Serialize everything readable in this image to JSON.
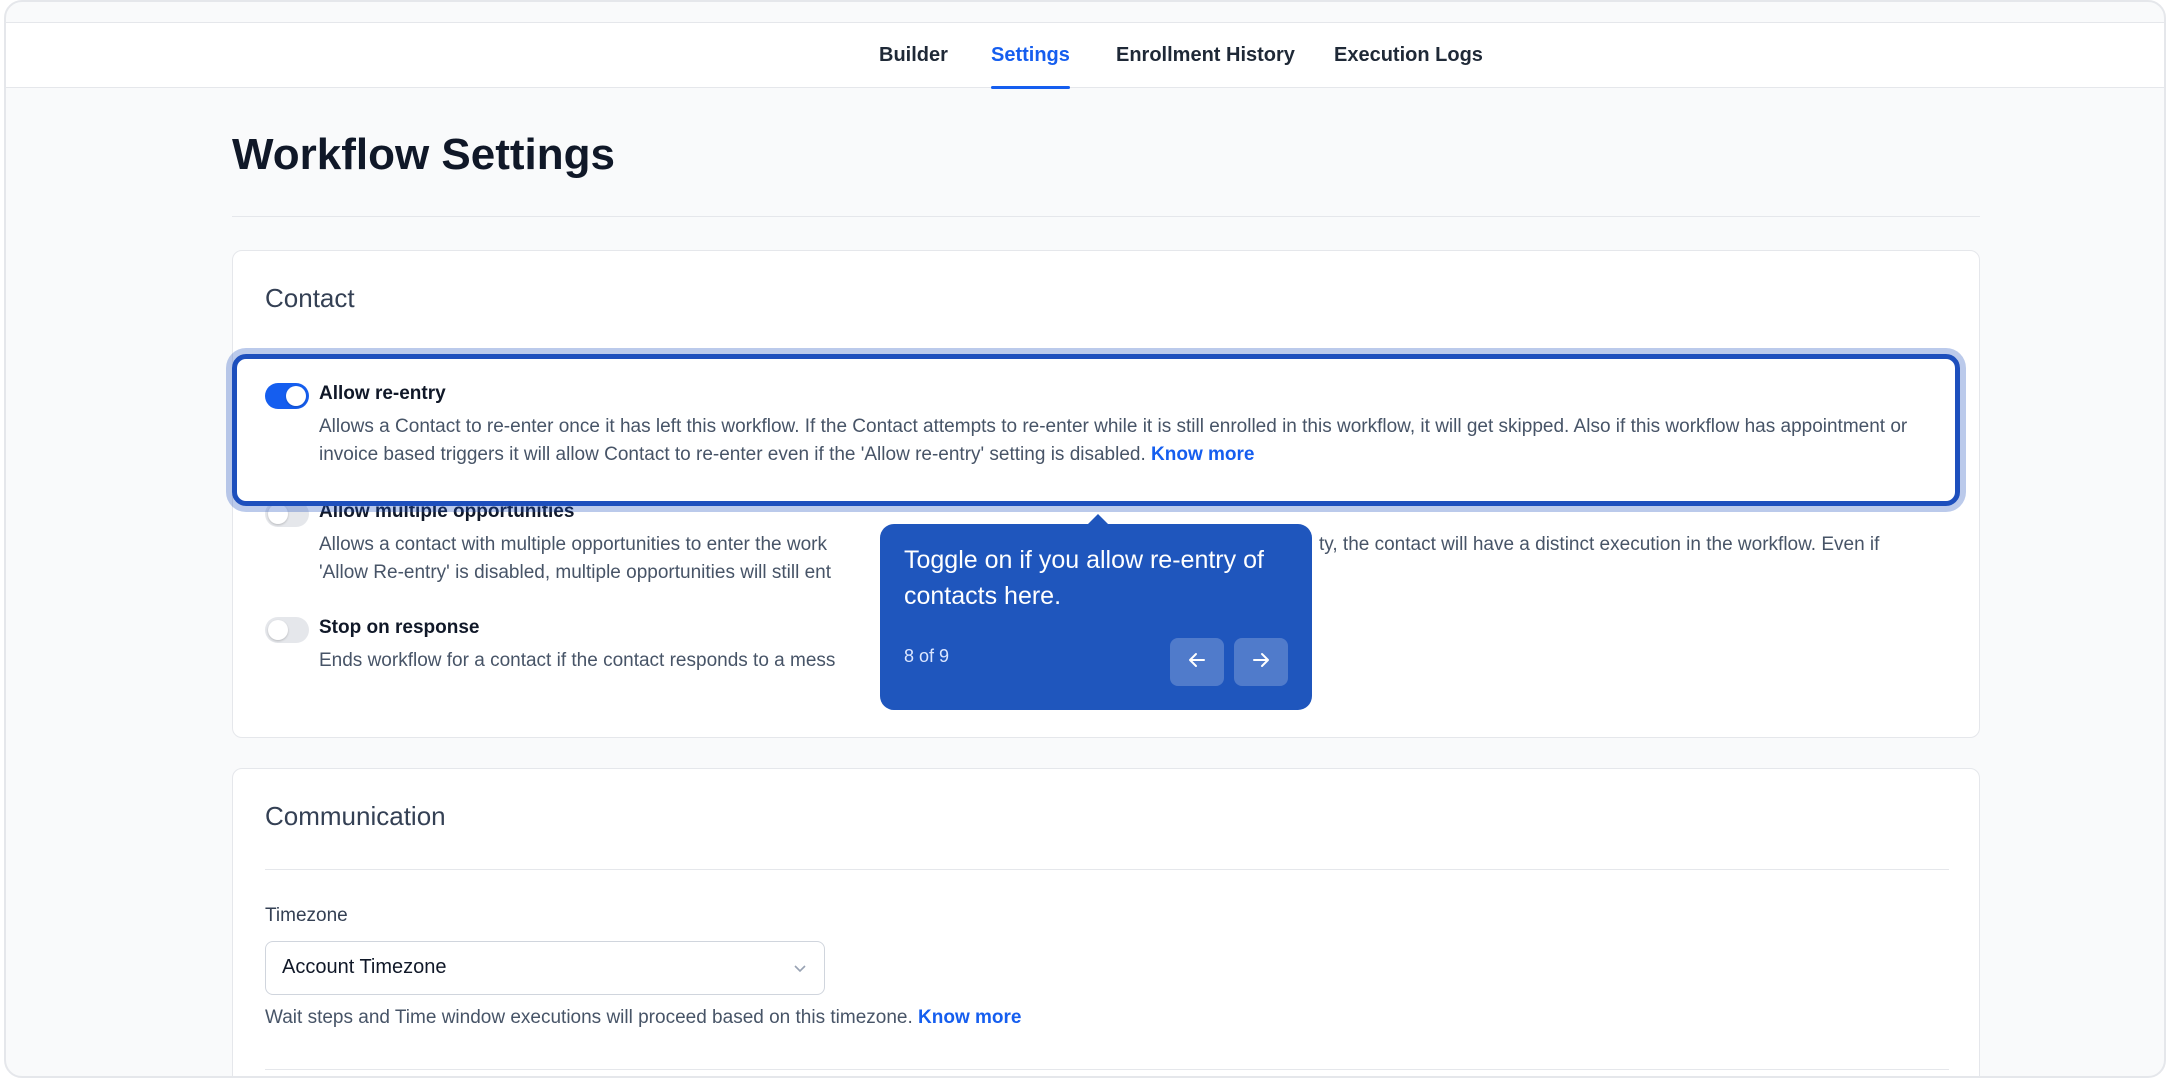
{
  "tabs": [
    {
      "label": "Builder"
    },
    {
      "label": "Settings"
    },
    {
      "label": "Enrollment History"
    },
    {
      "label": "Execution Logs"
    }
  ],
  "page_title": "Workflow Settings",
  "contact": {
    "title": "Contact",
    "settings": [
      {
        "label": "Allow re-entry",
        "enabled": true,
        "description": "Allows a Contact to re-enter once it has left this workflow. If the Contact attempts to re-enter while it is still enrolled in this workflow, it will get skipped. Also if this workflow has appointment or invoice based triggers it will allow Contact to re-enter even if the 'Allow re-entry' setting is disabled.",
        "link": "Know more"
      },
      {
        "label": "Allow multiple opportunities",
        "enabled": false,
        "description_start": "Allows a contact with multiple opportunities to enter the work",
        "description_end": "ty, the contact will have a distinct execution in the workflow. Even if",
        "description_line2": "'Allow Re-entry' is disabled, multiple opportunities will still ent"
      },
      {
        "label": "Stop on response",
        "enabled": false,
        "description": "Ends workflow for a contact if the contact responds to a mess"
      }
    ]
  },
  "tooltip": {
    "text": "Toggle on if you allow re-entry of contacts here.",
    "step": "8 of 9"
  },
  "communication": {
    "title": "Communication",
    "timezone_label": "Timezone",
    "timezone_value": "Account Timezone",
    "help_text": "Wait steps and Time window executions will proceed based on this timezone.",
    "help_link": "Know more"
  },
  "colors": {
    "accent": "#155eef",
    "tooltip_bg": "#1f56bd"
  }
}
